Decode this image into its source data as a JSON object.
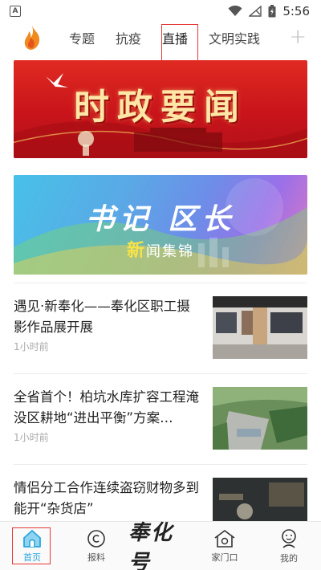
{
  "status_bar": {
    "app_icon": "A",
    "time": "5:56"
  },
  "tabs": [
    {
      "label": "专题"
    },
    {
      "label": "抗疫"
    },
    {
      "label": "直播"
    },
    {
      "label": "文明实践"
    }
  ],
  "banners": {
    "first": {
      "title": "时政要闻"
    },
    "second": {
      "title": "书记 区长",
      "sub_first": "新",
      "sub_rest": "闻集锦"
    }
  },
  "news": [
    {
      "title": "遇见·新奉化——奉化区职工摄影作品展开展",
      "time": "1小时前"
    },
    {
      "title": "全省首个！柏坑水库扩容工程淹没区耕地“进出平衡”方案…",
      "time": "1小时前"
    },
    {
      "title": "情侣分工合作连续盗窃财物多到能开“杂货店”",
      "time": ""
    }
  ],
  "bottom_nav": {
    "home": "首页",
    "report": "报料",
    "brand": "奉化号",
    "door": "家门口",
    "mine": "我的"
  },
  "colors": {
    "accent": "#29a7de",
    "highlight": "#e53935",
    "banner_red": "#d01c1c"
  }
}
